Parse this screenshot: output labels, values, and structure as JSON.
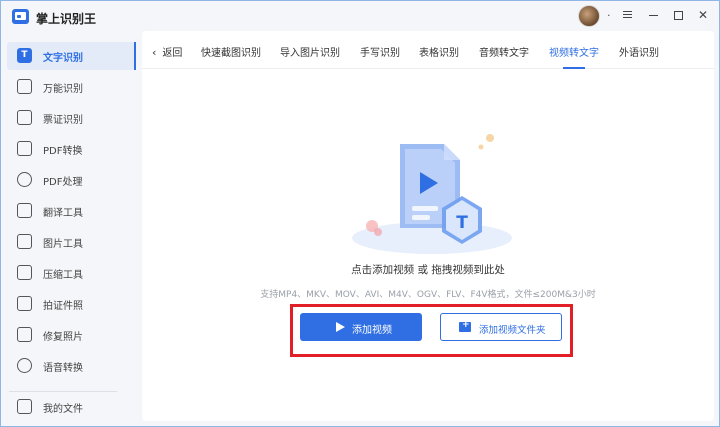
{
  "app": {
    "title": "掌上识别王"
  },
  "titlebar": {
    "dot": "·"
  },
  "sidebar": {
    "items": [
      {
        "label": "文字识别",
        "icon": "text-recognition-icon",
        "glyph": "T",
        "active": true
      },
      {
        "label": "万能识别",
        "icon": "universal-scan-icon"
      },
      {
        "label": "票证识别",
        "icon": "ticket-icon"
      },
      {
        "label": "PDF转换",
        "icon": "pdf-convert-icon"
      },
      {
        "label": "PDF处理",
        "icon": "pdf-process-icon"
      },
      {
        "label": "翻译工具",
        "icon": "translate-icon"
      },
      {
        "label": "图片工具",
        "icon": "image-tool-icon"
      },
      {
        "label": "压缩工具",
        "icon": "compress-icon"
      },
      {
        "label": "拍证件照",
        "icon": "id-photo-icon"
      },
      {
        "label": "修复照片",
        "icon": "photo-repair-icon"
      },
      {
        "label": "语音转换",
        "icon": "voice-convert-icon"
      }
    ],
    "my_files": {
      "label": "我的文件",
      "icon": "my-files-icon"
    }
  },
  "tabs": {
    "back_label": "返回",
    "items": [
      {
        "label": "快速截图识别"
      },
      {
        "label": "导入图片识别"
      },
      {
        "label": "手写识别"
      },
      {
        "label": "表格识别"
      },
      {
        "label": "音频转文字"
      },
      {
        "label": "视频转文字",
        "active": true
      },
      {
        "label": "外语识别"
      }
    ]
  },
  "main": {
    "prompt": "点击添加视频 或 拖拽视频到此处",
    "formats": "支持MP4、MKV、MOV、AVI、M4V、OGV、FLV、F4V格式，文件≤200M&3小时",
    "add_video_label": "添加视频",
    "add_folder_label": "添加视频文件夹"
  },
  "colors": {
    "accent": "#2f6fe3",
    "highlight": "#e21f26"
  }
}
